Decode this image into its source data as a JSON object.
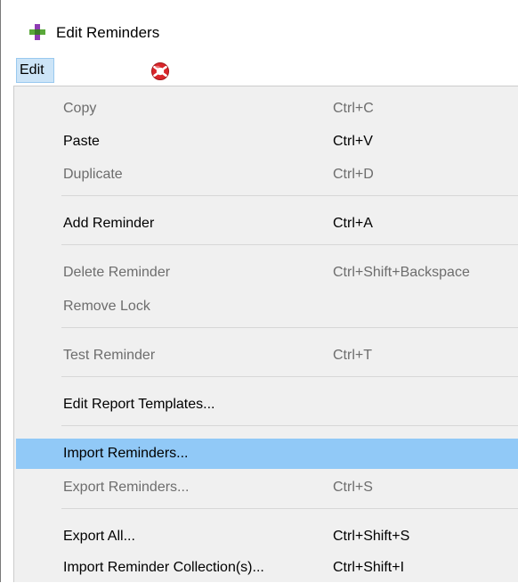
{
  "window": {
    "title": "Edit Reminders",
    "colors": {
      "highlight": "#91c9f7",
      "menu_background": "#f0f0f0",
      "disabled_text": "#6d6d6d"
    }
  },
  "menubar": {
    "edit_label": "Edit",
    "toolbar_icon": "red-lifebuoy-icon"
  },
  "menu": {
    "items": [
      {
        "label": "Copy",
        "shortcut": "Ctrl+C",
        "disabled": true
      },
      {
        "label": "Paste",
        "shortcut": "Ctrl+V",
        "disabled": false
      },
      {
        "label": "Duplicate",
        "shortcut": "Ctrl+D",
        "disabled": true
      },
      {
        "label": "Add Reminder",
        "shortcut": "Ctrl+A",
        "disabled": false
      },
      {
        "label": "Delete Reminder",
        "shortcut": "Ctrl+Shift+Backspace",
        "disabled": true
      },
      {
        "label": "Remove Lock",
        "shortcut": "",
        "disabled": true
      },
      {
        "label": "Test Reminder",
        "shortcut": "Ctrl+T",
        "disabled": true
      },
      {
        "label": "Edit Report Templates...",
        "shortcut": "",
        "disabled": false
      },
      {
        "label": "Import Reminders...",
        "shortcut": "",
        "disabled": false,
        "highlighted": true
      },
      {
        "label": "Export Reminders...",
        "shortcut": "Ctrl+S",
        "disabled": true
      },
      {
        "label": "Export All...",
        "shortcut": "Ctrl+Shift+S",
        "disabled": false
      },
      {
        "label": "Import Reminder Collection(s)...",
        "shortcut": "Ctrl+Shift+I",
        "disabled": false
      }
    ]
  }
}
